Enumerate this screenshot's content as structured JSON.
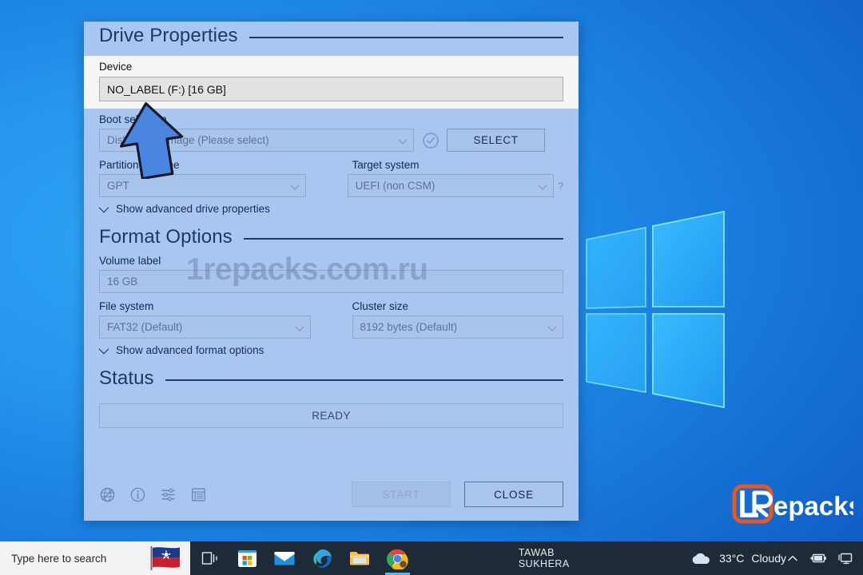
{
  "app": {
    "sections": {
      "drive_properties": "Drive Properties",
      "format_options": "Format Options",
      "status": "Status"
    },
    "device": {
      "label": "Device",
      "value": "NO_LABEL (F:) [16 GB]"
    },
    "boot_selection": {
      "label": "Boot selection",
      "value": "Disk or ISO image (Please select)",
      "select_button": "SELECT"
    },
    "partition_scheme": {
      "label": "Partition scheme",
      "value": "GPT"
    },
    "target_system": {
      "label": "Target system",
      "value": "UEFI (non CSM)",
      "help_marker": "?"
    },
    "advanced_drive_toggle": "Show advanced drive properties",
    "volume_label": {
      "label": "Volume label",
      "value": "16 GB"
    },
    "file_system": {
      "label": "File system",
      "value": "FAT32 (Default)"
    },
    "cluster_size": {
      "label": "Cluster size",
      "value": "8192 bytes (Default)"
    },
    "advanced_format_toggle": "Show advanced format options",
    "status_text": "READY",
    "toolbar_icons": [
      "globe-language-icon",
      "info-about-icon",
      "settings-sliders-icon",
      "log-list-icon"
    ],
    "buttons": {
      "start": "START",
      "close": "CLOSE"
    },
    "colors": {
      "dialog_background": "#a8c6f0",
      "heading": "#1f3864",
      "device_highlight": "#f5f5f5"
    }
  },
  "watermark": {
    "text": "1repacks.com.ru"
  },
  "branding": {
    "logo_mark": "LR",
    "logo_text": "epacks",
    "accent": "#e8571f"
  },
  "desktop": {
    "wallpaper": "windows-10-logo"
  },
  "taskbar": {
    "search_placeholder": "Type here to search",
    "flag_icon": "juneteenth-flag-icon",
    "pinned": [
      {
        "name": "task-view-icon",
        "active": false
      },
      {
        "name": "microsoft-store-icon",
        "active": false
      },
      {
        "name": "mail-icon",
        "active": false
      },
      {
        "name": "microsoft-edge-icon",
        "active": false
      },
      {
        "name": "file-explorer-icon",
        "active": false
      },
      {
        "name": "google-chrome-icon",
        "active": true
      }
    ],
    "user_name": "TAWAB SUKHERA",
    "weather": {
      "icon": "cloud-icon",
      "temperature": "33°C",
      "condition": "Cloudy"
    },
    "tray": [
      "chevron-up-icon",
      "battery-charging-icon",
      "network-monitor-icon"
    ]
  }
}
